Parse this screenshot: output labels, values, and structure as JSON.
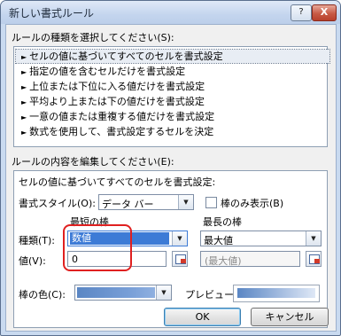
{
  "window": {
    "title": "新しい書式ルール",
    "help_button": "?",
    "close_button": "X"
  },
  "rule_type": {
    "label": "ルールの種類を選択してください(S):",
    "items": [
      {
        "label": "セルの値に基づいてすべてのセルを書式設定",
        "selected": true
      },
      {
        "label": "指定の値を含むセルだけを書式設定",
        "selected": false
      },
      {
        "label": "上位または下位に入る値だけを書式設定",
        "selected": false
      },
      {
        "label": "平均より上または下の値だけを書式設定",
        "selected": false
      },
      {
        "label": "一意の値または重複する値だけを書式設定",
        "selected": false
      },
      {
        "label": "数式を使用して、書式設定するセルを決定",
        "selected": false
      }
    ]
  },
  "rule_edit": {
    "label": "ルールの内容を編集してください(E):",
    "subtitle": "セルの値に基づいてすべてのセルを書式設定:",
    "format_style": {
      "label": "書式スタイル(O):",
      "value": "データ バー"
    },
    "show_bar_only": {
      "label": "棒のみ表示(B)",
      "checked": false
    },
    "shortest_bar": {
      "heading": "最短の棒",
      "type_value": "数値",
      "value": "0"
    },
    "longest_bar": {
      "heading": "最長の棒",
      "type_value": "最大値",
      "value": "(最大値)"
    },
    "type_label": "種類(T):",
    "value_label": "値(V):",
    "bar_color": {
      "label": "棒の色(C):",
      "color": "#6a93cf"
    },
    "preview_label": "プレビュー:"
  },
  "buttons": {
    "ok": "OK",
    "cancel": "キャンセル"
  },
  "icons": {
    "dropdown": "▼",
    "bullet": "►"
  }
}
